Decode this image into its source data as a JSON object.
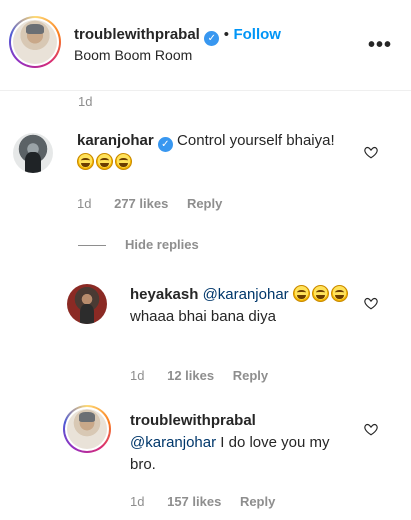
{
  "post_header": {
    "username": "troublewithprabal",
    "separator": "•",
    "follow_label": "Follow",
    "location": "Boom Boom Room",
    "more_icon": "•••"
  },
  "prev_comment": {
    "timestamp": "1d"
  },
  "comments": [
    {
      "username": "karanjohar",
      "verified": true,
      "text": "Control yourself bhaiya!",
      "emojis": 3,
      "timestamp": "1d",
      "likes": "277 likes",
      "reply_label": "Reply"
    }
  ],
  "hide_replies_label": "Hide replies",
  "replies": [
    {
      "username": "heyakash",
      "mention": "@karanjohar",
      "text": "whaaa bhai bana diya",
      "timestamp": "1d",
      "likes": "12 likes",
      "reply_label": "Reply"
    },
    {
      "username": "troublewithprabal",
      "mention": "@karanjohar",
      "text": "I do love you my bro.",
      "timestamp": "1d",
      "likes": "157 likes",
      "reply_label": "Reply"
    }
  ],
  "icons": {
    "verified": "verified-badge-icon",
    "heart": "heart-outline-icon",
    "emoji": "grinning-squinting-face-icon"
  },
  "colors": {
    "link_blue": "#0095f6",
    "verified_blue": "#3897f0",
    "meta_gray": "#8e8e8e",
    "mention_blue": "#00376b"
  }
}
